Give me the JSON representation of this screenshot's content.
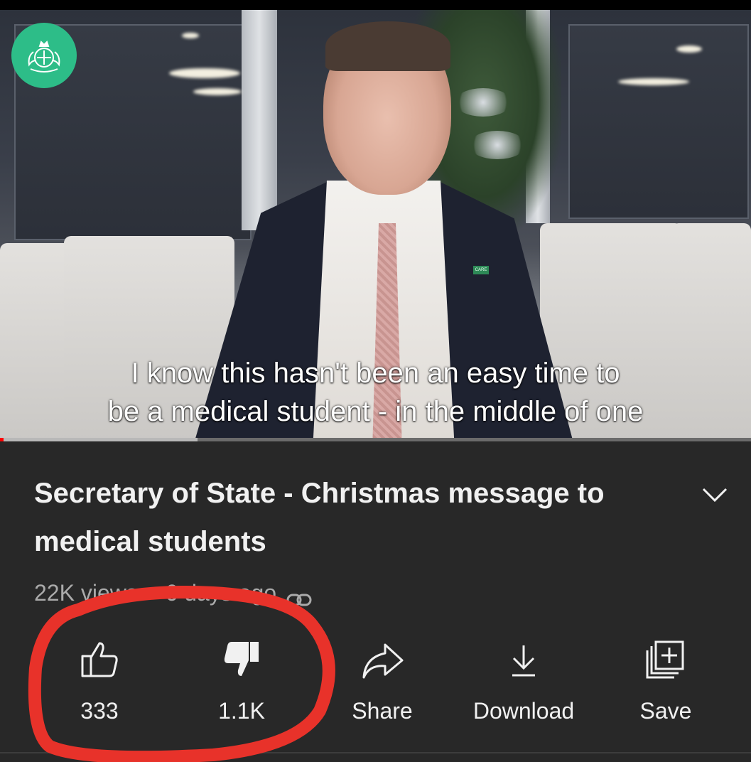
{
  "video": {
    "subtitle_line1": "I know this hasn't been an easy time to",
    "subtitle_line2": "be a medical student - in the middle of one",
    "lapel_pin_text": "CARE",
    "progress_played_fraction": 0.005,
    "progress_buffered_fraction": 0.263
  },
  "details": {
    "title": "Secretary of State - Christmas message to medical students",
    "views": "22K views",
    "age": "6 days ago"
  },
  "actions": [
    {
      "label": "333",
      "icon": "thumbs-up-icon"
    },
    {
      "label": "1.1K",
      "icon": "thumbs-down-icon"
    },
    {
      "label": "Share",
      "icon": "share-icon"
    },
    {
      "label": "Download",
      "icon": "download-icon"
    },
    {
      "label": "Save",
      "icon": "save-to-playlist-icon"
    }
  ],
  "colors": {
    "background": "#282828",
    "text": "#f1f1f1",
    "secondary_text": "#aaaaaa",
    "progress": "#ff0000",
    "logo": "#2dbd88",
    "annotation": "#e8322a"
  }
}
